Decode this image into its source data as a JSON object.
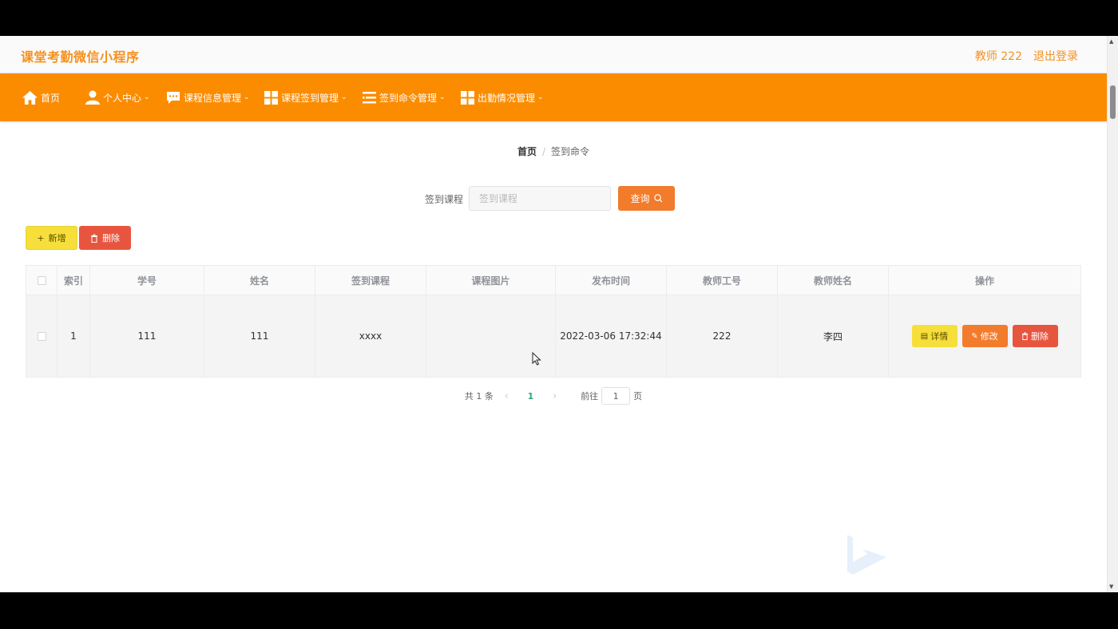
{
  "header": {
    "app_title": "课堂考勤微信小程序",
    "user": "教师 222",
    "logout": "退出登录"
  },
  "nav": {
    "items": [
      {
        "label": "首页",
        "icon": "home-icon",
        "dropdown": false
      },
      {
        "label": "个人中心",
        "icon": "user-icon",
        "dropdown": true
      },
      {
        "label": "课程信息管理",
        "icon": "chat-icon",
        "dropdown": true
      },
      {
        "label": "课程签到管理",
        "icon": "grid-icon",
        "dropdown": true
      },
      {
        "label": "签到命令管理",
        "icon": "list-icon",
        "dropdown": true
      },
      {
        "label": "出勤情况管理",
        "icon": "grid-icon",
        "dropdown": true
      }
    ]
  },
  "breadcrumb": {
    "home": "首页",
    "separator": "/",
    "current": "签到命令"
  },
  "search": {
    "label": "签到课程",
    "placeholder": "签到课程",
    "button": "查询"
  },
  "actions": {
    "add": "新增",
    "delete": "删除"
  },
  "table": {
    "columns": [
      "索引",
      "学号",
      "姓名",
      "签到课程",
      "课程图片",
      "发布时间",
      "教师工号",
      "教师姓名",
      "操作"
    ],
    "rows": [
      {
        "index": "1",
        "student_id": "111",
        "name": "111",
        "course": "xxxx",
        "image": "",
        "publish_time": "2022-03-06 17:32:44",
        "teacher_id": "222",
        "teacher_name": "李四"
      }
    ],
    "row_actions": {
      "detail": "详情",
      "edit": "修改",
      "delete": "删除"
    }
  },
  "pagination": {
    "total": "共 1 条",
    "current_page": "1",
    "goto_label": "前往",
    "goto_value": "1",
    "page_suffix": "页"
  },
  "colors": {
    "brand": "#fb8c00",
    "title": "#f5901c",
    "yellow": "#f6df3b",
    "orange": "#f27b2c",
    "red": "#e8553f",
    "active_page": "#2ea872"
  }
}
